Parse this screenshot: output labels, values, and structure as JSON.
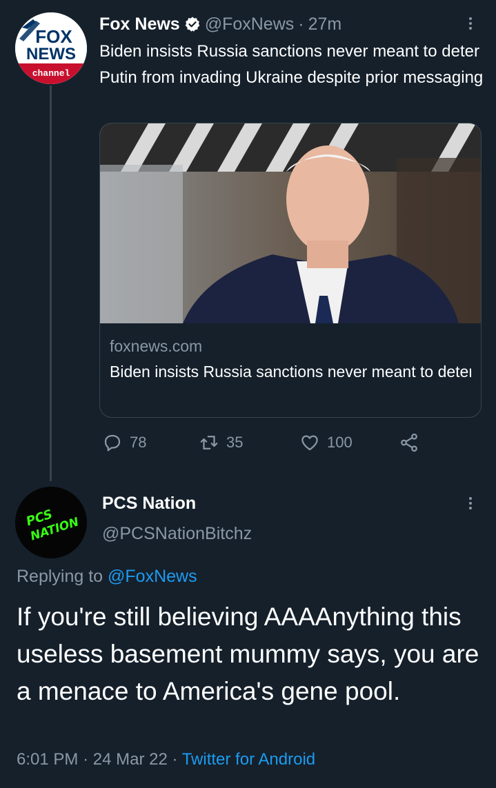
{
  "tweet": {
    "author_name": "Fox News",
    "handle": "@FoxNews",
    "separator": "·",
    "age": "27m",
    "text": "Biden insists Russia sanctions never meant to deter Putin from invading Ukraine despite prior messaging",
    "avatar_logo": {
      "line1": "FOX",
      "line2": "NEWS",
      "line3": "channel"
    },
    "card": {
      "domain": "foxnews.com",
      "title": "Biden insists Russia sanctions never meant to deter Putin from invading Ukra..."
    },
    "stats": {
      "replies": "78",
      "retweets": "35",
      "likes": "100"
    }
  },
  "reply": {
    "author_name": "PCS Nation",
    "handle": "@PCSNationBitchz",
    "avatar_text": {
      "line1": "PCS",
      "line2": "NATION"
    },
    "replying_prefix": "Replying to",
    "replying_to": "@FoxNews",
    "text": "If you're still believing AAAAnything this useless basement mummy says, you are a menace to America's gene pool.",
    "time": "6:01 PM",
    "date": "24 Mar 22",
    "separator": "·",
    "source": "Twitter for Android"
  },
  "colors": {
    "background": "#15202b",
    "muted": "#8b98a5",
    "link": "#1d9bf0",
    "border": "#38444d",
    "fox_red": "#c8102e",
    "fox_blue": "#003366",
    "pcs_green": "#39ff14"
  },
  "icons": [
    "verified-badge-icon",
    "more-icon",
    "reply-icon",
    "retweet-icon",
    "like-icon",
    "share-icon"
  ]
}
